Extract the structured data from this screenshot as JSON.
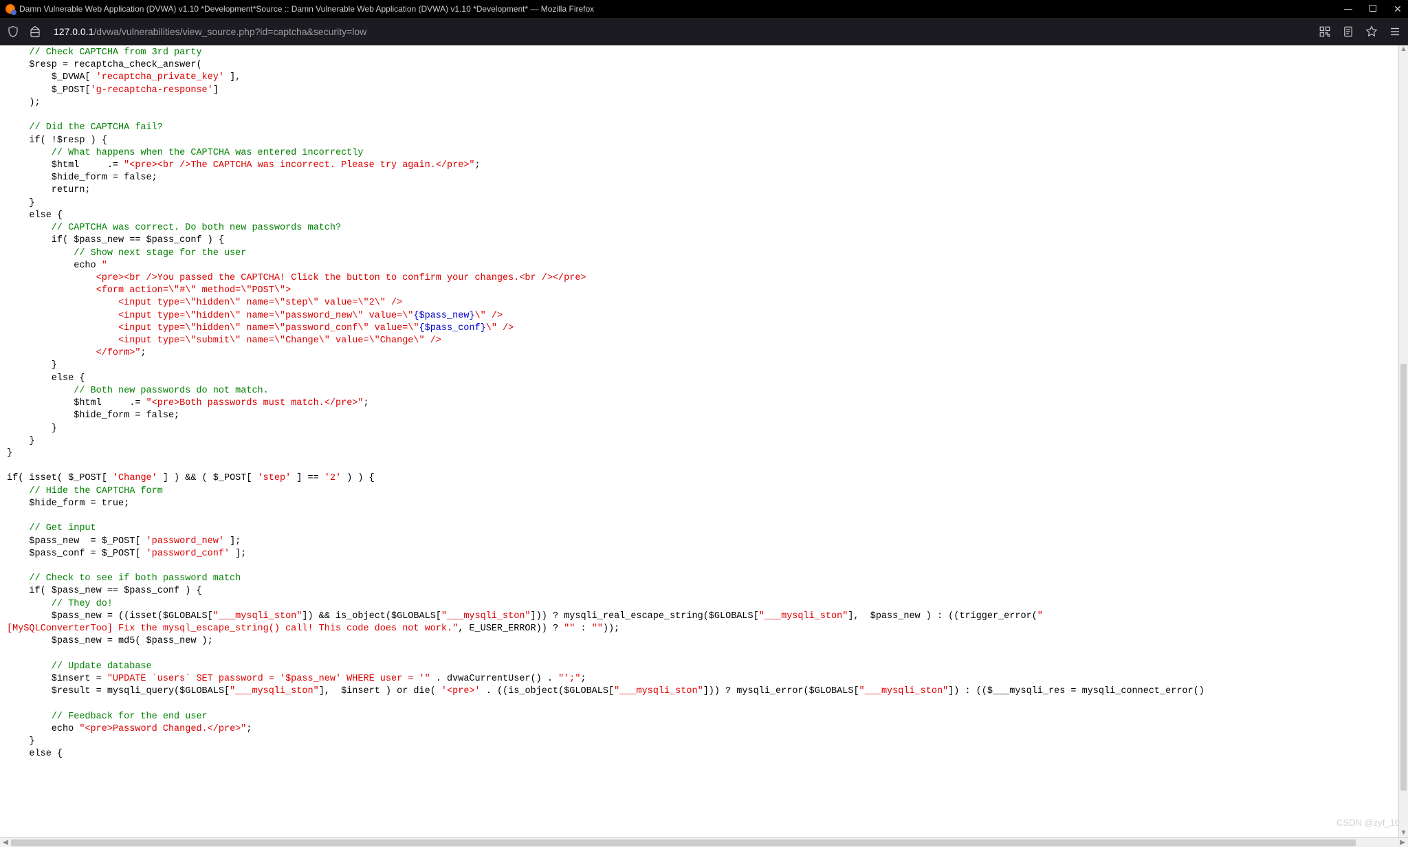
{
  "window": {
    "title": "Damn Vulnerable Web Application (DVWA) v1.10 *Development*Source :: Damn Vulnerable Web Application (DVWA) v1.10 *Development* — Mozilla Firefox"
  },
  "url": {
    "host": "127.0.0.1",
    "path": "/dvwa/vulnerabilities/view_source.php?id=captcha&security=low"
  },
  "watermark": "CSDN @zyf_16",
  "code": {
    "l01": "    // Check CAPTCHA from 3rd party",
    "l02a": "    $resp = recaptcha_check_answer(",
    "l03a": "        $_DVWA[ ",
    "l03s": "'recaptcha_private_key'",
    "l03b": " ],",
    "l04a": "        $_POST[",
    "l04s": "'g-recaptcha-response'",
    "l04b": "]",
    "l05": "    );",
    "l06": "    // Did the CAPTCHA fail?",
    "l07": "    if( !$resp ) {",
    "l08": "        // What happens when the CAPTCHA was entered incorrectly",
    "l09a": "        $html     .= ",
    "l09s": "\"<pre><br />The CAPTCHA was incorrect. Please try again.</pre>\"",
    "l09b": ";",
    "l10": "        $hide_form = false;",
    "l11": "        return;",
    "l12": "    }",
    "l13": "    else {",
    "l14": "        // CAPTCHA was correct. Do both new passwords match?",
    "l15": "        if( $pass_new == $pass_conf ) {",
    "l16": "            // Show next stage for the user",
    "l17a": "            echo ",
    "l17s": "\"",
    "l18": "                <pre><br />You passed the CAPTCHA! Click the button to confirm your changes.<br /></pre>",
    "l19": "                <form action=\\\"#\\\" method=\\\"POST\\\">",
    "l20": "                    <input type=\\\"hidden\\\" name=\\\"step\\\" value=\\\"2\\\" />",
    "l21a": "                    <input type=\\\"hidden\\\" name=\\\"password_new\\\" value=\\\"",
    "l21v": "{$pass_new}",
    "l21b": "\\\" />",
    "l22a": "                    <input type=\\\"hidden\\\" name=\\\"password_conf\\\" value=\\\"",
    "l22v": "{$pass_conf}",
    "l22b": "\\\" />",
    "l23": "                    <input type=\\\"submit\\\" name=\\\"Change\\\" value=\\\"Change\\\" />",
    "l24a": "                </form>\"",
    "l24b": ";",
    "l25": "        }",
    "l26": "        else {",
    "l27": "            // Both new passwords do not match.",
    "l28a": "            $html     .= ",
    "l28s": "\"<pre>Both passwords must match.</pre>\"",
    "l28b": ";",
    "l29": "            $hide_form = false;",
    "l30": "        }",
    "l31": "    }",
    "l32": "}",
    "l33a": "if( isset( $_POST[ ",
    "l33s1": "'Change'",
    "l33b": " ] ) && ( $_POST[ ",
    "l33s2": "'step'",
    "l33c": " ] == ",
    "l33s3": "'2'",
    "l33d": " ) ) {",
    "l34": "    // Hide the CAPTCHA form",
    "l35": "    $hide_form = true;",
    "l36": "    // Get input",
    "l37a": "    $pass_new  = $_POST[ ",
    "l37s": "'password_new'",
    "l37b": " ];",
    "l38a": "    $pass_conf = $_POST[ ",
    "l38s": "'password_conf'",
    "l38b": " ];",
    "l39": "    // Check to see if both password match",
    "l40": "    if( $pass_new == $pass_conf ) {",
    "l41": "        // They do!",
    "l42a": "        $pass_new = ((isset($GLOBALS[",
    "l42s1": "\"___mysqli_ston\"",
    "l42b": "]) && is_object($GLOBALS[",
    "l42s2": "\"___mysqli_ston\"",
    "l42c": "])) ? mysqli_real_escape_string($GLOBALS[",
    "l42s3": "\"___mysqli_ston\"",
    "l42d": "],  $pass_new ) : ((trigger_error(",
    "l42s4": "\"",
    "l43a": "[MySQLConverterToo] Fix the mysql_escape_string() call! This code does not work.\"",
    "l43b": ", E_USER_ERROR)) ? ",
    "l43s1": "\"\"",
    "l43c": " : ",
    "l43s2": "\"\"",
    "l43d": "));",
    "l44": "        $pass_new = md5( $pass_new );",
    "l45": "        // Update database",
    "l46a": "        $insert = ",
    "l46s": "\"UPDATE `users` SET password = '$pass_new' WHERE user = '\"",
    "l46b": " . dvwaCurrentUser() . ",
    "l46s2": "\"';\"",
    "l46c": ";",
    "l47a": "        $result = mysqli_query($GLOBALS[",
    "l47s1": "\"___mysqli_ston\"",
    "l47b": "],  $insert ) or die( ",
    "l47s2": "'<pre>'",
    "l47c": " . ((is_object($GLOBALS[",
    "l47s3": "\"___mysqli_ston\"",
    "l47d": "])) ? mysqli_error($GLOBALS[",
    "l47s4": "\"___mysqli_ston\"",
    "l47e": "]) : (($___mysqli_res = mysqli_connect_error()",
    "l48": "        // Feedback for the end user",
    "l49a": "        echo ",
    "l49s": "\"<pre>Password Changed.</pre>\"",
    "l49b": ";",
    "l50": "    }",
    "l51": "    else {"
  }
}
